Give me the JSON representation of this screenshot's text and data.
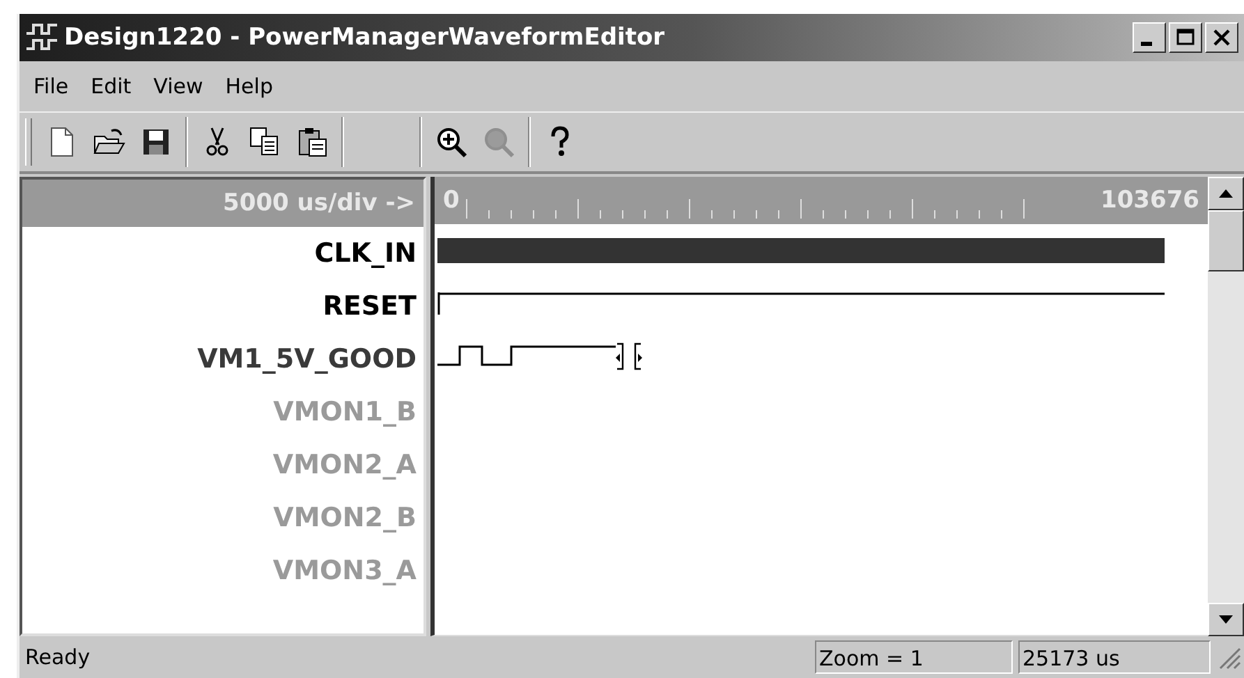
{
  "window": {
    "title": "Design1220 - PowerManagerWaveformEditor"
  },
  "menu": [
    "File",
    "Edit",
    "View",
    "Help"
  ],
  "toolbar": [
    {
      "kind": "new",
      "disabled": false
    },
    {
      "kind": "open",
      "disabled": false
    },
    {
      "kind": "save",
      "disabled": false
    },
    {
      "kind": "separator"
    },
    {
      "kind": "cut",
      "disabled": false
    },
    {
      "kind": "copy",
      "disabled": false
    },
    {
      "kind": "paste",
      "disabled": false
    },
    {
      "kind": "separator"
    },
    {
      "kind": "gap"
    },
    {
      "kind": "separator"
    },
    {
      "kind": "zoom_in",
      "disabled": false
    },
    {
      "kind": "zoom_out",
      "disabled": true
    },
    {
      "kind": "separator"
    },
    {
      "kind": "help",
      "disabled": false
    }
  ],
  "scale": {
    "label": "5000 us/div ->",
    "start": "0",
    "end": "103676"
  },
  "signals": [
    {
      "name": "CLK_IN",
      "enabled": true,
      "highlighted": true,
      "kind": "clock"
    },
    {
      "name": "RESET",
      "enabled": true,
      "highlighted": true,
      "kind": "low"
    },
    {
      "name": "VM1_5V_GOOD",
      "enabled": true,
      "highlighted": false,
      "kind": "pulses"
    },
    {
      "name": "VMON1_B",
      "enabled": false,
      "highlighted": false,
      "kind": "empty"
    },
    {
      "name": "VMON2_A",
      "enabled": false,
      "highlighted": false,
      "kind": "empty"
    },
    {
      "name": "VMON2_B",
      "enabled": false,
      "highlighted": false,
      "kind": "empty"
    },
    {
      "name": "VMON3_A",
      "enabled": false,
      "highlighted": false,
      "kind": "empty"
    }
  ],
  "status_bar": {
    "message": "Ready",
    "zoom": "Zoom = 1",
    "time": "25173 us"
  }
}
